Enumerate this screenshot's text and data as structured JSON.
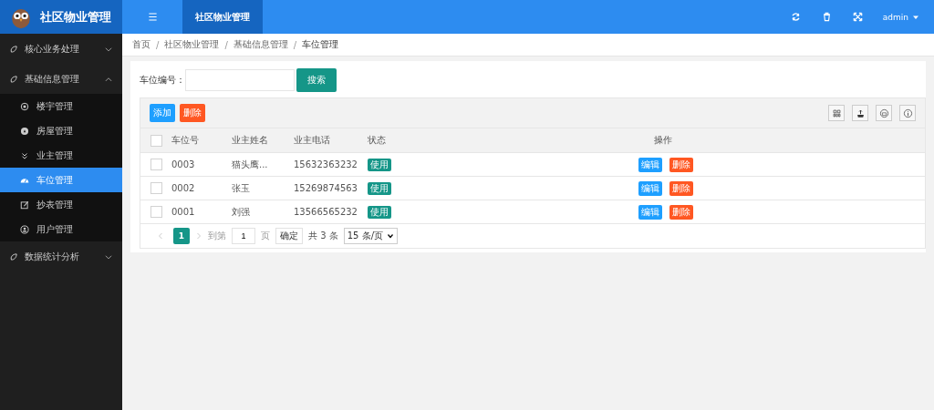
{
  "app": {
    "title": "社区物业管理"
  },
  "header": {
    "tabs": [
      {
        "label": "社区物业管理",
        "selected": true
      }
    ],
    "user": "admin"
  },
  "sidebar": {
    "items": [
      {
        "label": "核心业务处理",
        "expanded": false
      },
      {
        "label": "基础信息管理",
        "expanded": true,
        "children": [
          {
            "label": "楼宇管理",
            "selected": false
          },
          {
            "label": "房屋管理",
            "selected": false
          },
          {
            "label": "业主管理",
            "selected": false
          },
          {
            "label": "车位管理",
            "selected": true
          },
          {
            "label": "抄表管理",
            "selected": false
          },
          {
            "label": "用户管理",
            "selected": false
          }
        ]
      },
      {
        "label": "数据统计分析",
        "expanded": false
      }
    ]
  },
  "breadcrumb": {
    "separator": "/",
    "items": [
      "首页",
      "社区物业管理",
      "基础信息管理",
      "车位管理"
    ]
  },
  "search": {
    "label": "车位编号：",
    "button": "搜索"
  },
  "toolbar": {
    "add": "添加",
    "delete": "删除"
  },
  "table": {
    "select_all_checked": false,
    "columns": [
      "车位号",
      "业主姓名",
      "业主电话",
      "状态",
      "操作"
    ],
    "rows": [
      {
        "checked": false,
        "cells": [
          "0003",
          "猫头鹰...",
          "15632363232"
        ],
        "status": "使用",
        "actions": [
          "编辑",
          "删除"
        ]
      },
      {
        "checked": false,
        "cells": [
          "0002",
          "张玉",
          "15269874563"
        ],
        "status": "使用",
        "actions": [
          "编辑",
          "删除"
        ]
      },
      {
        "checked": false,
        "cells": [
          "0001",
          "刘强",
          "13566565232"
        ],
        "status": "使用",
        "actions": [
          "编辑",
          "删除"
        ]
      }
    ]
  },
  "pager": {
    "current": "1",
    "goto_label": "到第",
    "goto_value": "1",
    "page_label": "页",
    "confirm": "确定",
    "total": "共 3 条",
    "page_size": "15 条/页"
  }
}
